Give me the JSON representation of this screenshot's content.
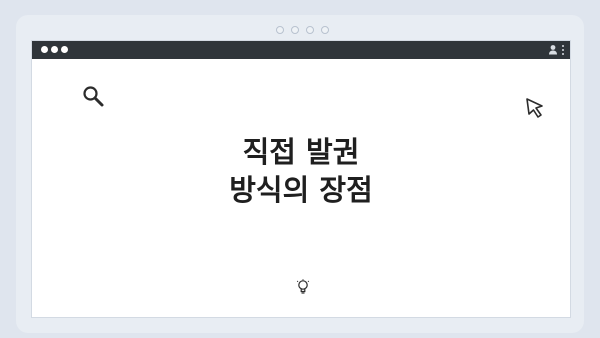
{
  "page": {
    "background": "#dfe5ee",
    "frame_color": "#e8edf3"
  },
  "window": {
    "titlebar_color": "#2f353a",
    "traffic_lights": [
      "dot",
      "dot",
      "dot"
    ],
    "titlebar_icons": [
      "user-icon",
      "kebab-menu-icon"
    ]
  },
  "content": {
    "title_lines": [
      "직접 발권",
      "방식의 장점"
    ],
    "title_color": "#1f1f1f",
    "icons": [
      "search-icon",
      "cursor-arrow-icon",
      "lightbulb-icon"
    ]
  }
}
